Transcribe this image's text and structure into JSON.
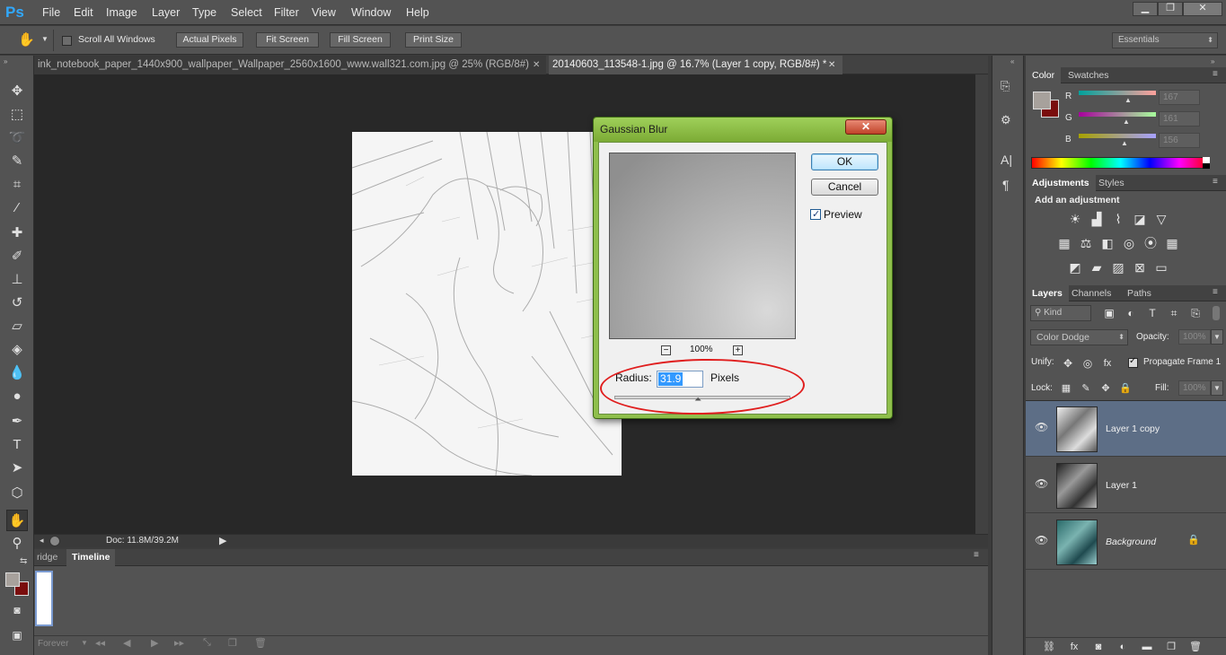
{
  "app": {
    "logo": "Ps"
  },
  "menu": [
    "File",
    "Edit",
    "Image",
    "Layer",
    "Type",
    "Select",
    "Filter",
    "View",
    "Window",
    "Help"
  ],
  "window_controls": {
    "minimize": "▁",
    "restore": "❐",
    "close": "✕"
  },
  "options_bar": {
    "scroll_all_windows": "Scroll All Windows",
    "actual_pixels": "Actual Pixels",
    "fit_screen": "Fit Screen",
    "fill_screen": "Fill Screen",
    "print_size": "Print Size",
    "workspace": "Essentials"
  },
  "tabs": [
    {
      "label": "ink_notebook_paper_1440x900_wallpaper_Wallpaper_2560x1600_www.wall321.com.jpg @ 25% (RGB/8#)",
      "close": "✕"
    },
    {
      "label": "20140603_113548-1.jpg @ 16.7% (Layer 1 copy, RGB/8#) *",
      "close": "✕"
    }
  ],
  "status": {
    "doc": "Doc: 11.8M/39.2M"
  },
  "timeline": {
    "tabs": [
      "ridge",
      "Timeline"
    ],
    "loop": "Forever"
  },
  "color_panel": {
    "tabs": [
      "Color",
      "Swatches"
    ],
    "channels": [
      {
        "label": "R",
        "value": "167"
      },
      {
        "label": "G",
        "value": "161"
      },
      {
        "label": "B",
        "value": "156"
      }
    ],
    "foreground": "#a7a19c",
    "background": "#7a0d0d"
  },
  "adjustments_panel": {
    "tabs": [
      "Adjustments",
      "Styles"
    ],
    "heading": "Add an adjustment"
  },
  "layers_panel": {
    "tabs": [
      "Layers",
      "Channels",
      "Paths"
    ],
    "kind": "Kind",
    "blend_mode": "Color Dodge",
    "opacity_label": "Opacity:",
    "opacity": "100%",
    "unify_label": "Unify:",
    "propagate": "Propagate Frame 1",
    "lock_label": "Lock:",
    "fill_label": "Fill:",
    "fill": "100%",
    "layers": [
      {
        "name": "Layer 1 copy",
        "selected": true
      },
      {
        "name": "Layer 1",
        "selected": false
      },
      {
        "name": "Background",
        "selected": false
      }
    ]
  },
  "dialog": {
    "title": "Gaussian Blur",
    "close": "✕",
    "ok": "OK",
    "cancel": "Cancel",
    "preview_label": "Preview",
    "preview_checked": true,
    "zoom": "100%",
    "zoom_out": "−",
    "zoom_in": "+",
    "radius_label": "Radius:",
    "radius_value": "31.9",
    "radius_units": "Pixels",
    "radius_slider_level": 0.48
  }
}
